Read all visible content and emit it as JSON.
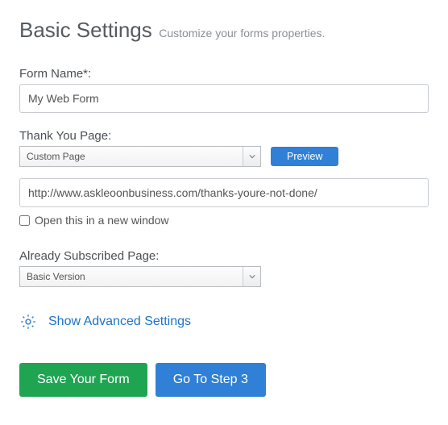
{
  "header": {
    "title": "Basic Settings",
    "subtitle": "Customize your forms properties."
  },
  "formName": {
    "label": "Form Name*:",
    "value": "My Web Form"
  },
  "thankYou": {
    "label": "Thank You Page:",
    "selectValue": "Custom Page",
    "previewLabel": "Preview",
    "url": "http://www.askleoonbusiness.com/thanks-youre-not-done/",
    "checkboxLabel": "Open this in a new window",
    "checkboxChecked": false
  },
  "alreadySubscribed": {
    "label": "Already Subscribed Page:",
    "selectValue": "Basic Version"
  },
  "advanced": {
    "linkLabel": "Show Advanced Settings"
  },
  "footer": {
    "saveLabel": "Save Your Form",
    "stepLabel": "Go To Step 3"
  }
}
